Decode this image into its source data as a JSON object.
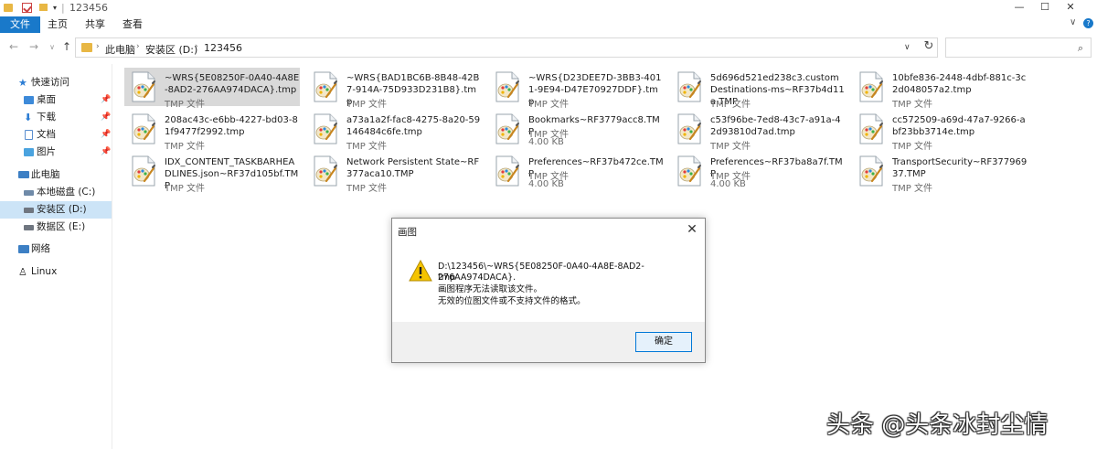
{
  "window": {
    "title": "123456",
    "controls": {
      "minimize": "—",
      "maximize": "☐",
      "close": "✕"
    }
  },
  "ribbon": {
    "tabs": [
      "文件",
      "主页",
      "共享",
      "查看"
    ]
  },
  "address": {
    "breadcrumbs": [
      "此电脑",
      "安装区 (D:)",
      "123456"
    ]
  },
  "sidebar": {
    "items": [
      {
        "label": "快速访问",
        "pinned": false
      },
      {
        "label": "桌面",
        "pinned": true
      },
      {
        "label": "下载",
        "pinned": true
      },
      {
        "label": "文档",
        "pinned": true
      },
      {
        "label": "图片",
        "pinned": true
      },
      {
        "label": "此电脑",
        "pinned": false
      },
      {
        "label": "本地磁盘 (C:)",
        "pinned": false
      },
      {
        "label": "安装区 (D:)",
        "pinned": false
      },
      {
        "label": "数据区 (E:)",
        "pinned": false
      },
      {
        "label": "网络",
        "pinned": false
      },
      {
        "label": "Linux",
        "pinned": false
      }
    ],
    "selected": "安装区 (D:)"
  },
  "files": [
    {
      "name": "~WRS{5E08250F-0A40-4A8E-8AD2-276AA974DACA}.tmp",
      "type": "TMP 文件",
      "size": ""
    },
    {
      "name": "~WRS{BAD1BC6B-8B48-42B7-914A-75D933D231B8}.tmp",
      "type": "TMP 文件",
      "size": ""
    },
    {
      "name": "~WRS{D23DEE7D-3BB3-4011-9E94-D47E70927DDF}.tmp",
      "type": "TMP 文件",
      "size": ""
    },
    {
      "name": "5d696d521ed238c3.customDestinations-ms~RF37b4d11a.TMP",
      "type": "TMP 文件",
      "size": ""
    },
    {
      "name": "10bfe836-2448-4dbf-881c-3c2d048057a2.tmp",
      "type": "TMP 文件",
      "size": ""
    },
    {
      "name": "208ac43c-e6bb-4227-bd03-81f9477f2992.tmp",
      "type": "TMP 文件",
      "size": ""
    },
    {
      "name": "a73a1a2f-fac8-4275-8a20-59146484c6fe.tmp",
      "type": "TMP 文件",
      "size": ""
    },
    {
      "name": "Bookmarks~RF3779acc8.TMP",
      "type": "TMP 文件",
      "size": "4.00 KB"
    },
    {
      "name": "c53f96be-7ed8-43c7-a91a-42d93810d7ad.tmp",
      "type": "TMP 文件",
      "size": ""
    },
    {
      "name": "cc572509-a69d-47a7-9266-abf23bb3714e.tmp",
      "type": "TMP 文件",
      "size": ""
    },
    {
      "name": "IDX_CONTENT_TASKBARHEADLINES.json~RF37d105bf.TMP",
      "type": "TMP 文件",
      "size": ""
    },
    {
      "name": "Network Persistent State~RF377aca10.TMP",
      "type": "TMP 文件",
      "size": ""
    },
    {
      "name": "Preferences~RF37b472ce.TMP",
      "type": "TMP 文件",
      "size": "4.00 KB"
    },
    {
      "name": "Preferences~RF37ba8a7f.TMP",
      "type": "TMP 文件",
      "size": "4.00 KB"
    },
    {
      "name": "TransportSecurity~RF37796937.TMP",
      "type": "TMP 文件",
      "size": ""
    }
  ],
  "selected_file_index": 0,
  "dialog": {
    "title": "画图",
    "lines": [
      "D:\\123456\\~WRS{5E08250F-0A40-4A8E-8AD2-276AA974DACA}.",
      "tmp",
      "画图程序无法读取该文件。",
      "无效的位图文件或不支持文件的格式。"
    ],
    "ok_label": "确定"
  },
  "watermark": "头条 @头条冰封尘情",
  "colors": {
    "accent": "#1979ca",
    "selection": "#cce4f7",
    "folder": "#e8b744",
    "warning": "#f5c400"
  }
}
